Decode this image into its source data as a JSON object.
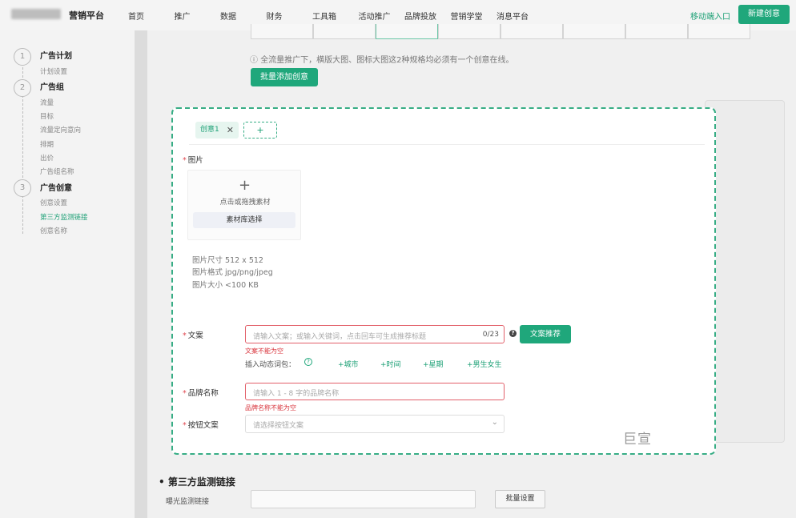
{
  "topbar": {
    "brand": "营销平台",
    "nav": [
      "首页",
      "推广",
      "数据",
      "财务",
      "工具箱",
      "活动推广",
      "品牌投放",
      "营销学堂",
      "消息平台"
    ],
    "mobile_link": "移动端入口",
    "new_button": "新建创意"
  },
  "sidebar": {
    "steps": [
      {
        "num": "1",
        "title": "广告计划",
        "items": [
          "计划设置"
        ]
      },
      {
        "num": "2",
        "title": "广告组",
        "items": [
          "流量",
          "目标",
          "流量定向意向",
          "排期",
          "出价",
          "广告组名称"
        ]
      },
      {
        "num": "3",
        "title": "广告创意",
        "items": [
          "创意设置",
          "第三方监测链接",
          "创意名称"
        ]
      }
    ],
    "active_item": "第三方监测链接"
  },
  "main": {
    "notice": "全流量推广下，横版大图、图标大图这2种规格均必须有一个创意在线。",
    "batch_add": "批量添加创意",
    "section_title": "第三方监测链接",
    "exposure_label": "曝光监测链接",
    "batch_set": "批量设置"
  },
  "modal": {
    "chip_label": "创意1",
    "chip_close": "✕",
    "add_chip": "+",
    "image_label": "图片",
    "upload_text": "点击或拖拽素材",
    "library_button": "素材库选择",
    "spec_size": "图片尺寸 512 x 512",
    "spec_format": "图片格式 jpg/png/jpeg",
    "spec_weight": "图片大小 <100 KB",
    "copy_label": "文案",
    "copy_placeholder": "请输入文案；或输入关键词，点击回车可生成推荐标题",
    "copy_counter": "0/23",
    "copy_help": "?",
    "copy_recommend": "文案推荐",
    "copy_error": "文案不能为空",
    "dynamic_label": "插入动态词包：",
    "dynamic_help": "?",
    "dynamic_tags": [
      "+城市",
      "+时间",
      "+星期",
      "+男生女生"
    ],
    "brand_label": "品牌名称",
    "brand_placeholder": "请输入 1 - 8 字的品牌名称",
    "brand_error": "品牌名称不能为空",
    "button_label": "按钮文案",
    "button_placeholder": "请选择按钮文案",
    "watermark": "巨宣"
  }
}
